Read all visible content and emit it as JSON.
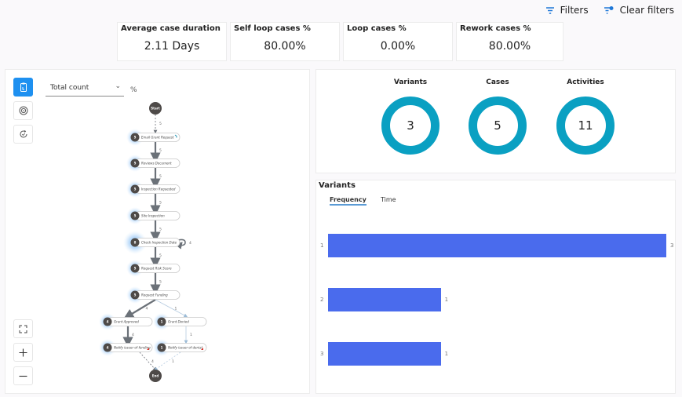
{
  "toolbar": {
    "filters_label": "Filters",
    "clear_filters_label": "Clear filters"
  },
  "kpis": [
    {
      "label": "Average case duration",
      "value": "2.11 Days"
    },
    {
      "label": "Self loop cases %",
      "value": "80.00%"
    },
    {
      "label": "Loop cases %",
      "value": "0.00%"
    },
    {
      "label": "Rework cases %",
      "value": "80.00%"
    }
  ],
  "process_map": {
    "metric_select": {
      "selected": "Total count",
      "unit": "%"
    },
    "tools": [
      "process-map-icon",
      "target-icon",
      "refresh-check-icon"
    ],
    "controls": [
      "fit-screen-icon",
      "zoom-in-icon",
      "zoom-out-icon"
    ],
    "start_label": "Start",
    "end_label": "End",
    "nodes": [
      {
        "id": "n1",
        "label": "Email Grant Request",
        "count": "5"
      },
      {
        "id": "n2",
        "label": "Reviews Document",
        "count": "5"
      },
      {
        "id": "n3",
        "label": "Inspection Requested",
        "count": "5"
      },
      {
        "id": "n4",
        "label": "Site Inspection",
        "count": "5"
      },
      {
        "id": "n5",
        "label": "Check Inspection Date",
        "count": "8"
      },
      {
        "id": "n6",
        "label": "Request Risk Score",
        "count": "5"
      },
      {
        "id": "n7",
        "label": "Request Funding",
        "count": "5"
      },
      {
        "id": "n8",
        "label": "Grant Approved",
        "count": "4"
      },
      {
        "id": "n9",
        "label": "Grant Denied",
        "count": "1"
      },
      {
        "id": "n10",
        "label": "Notify issuer of funding",
        "count": "4"
      },
      {
        "id": "n11",
        "label": "Notify issuer of denial",
        "count": "1"
      }
    ],
    "edges": [
      {
        "from": "start",
        "to": "n1",
        "count": "5"
      },
      {
        "from": "n1",
        "to": "n2",
        "count": "5"
      },
      {
        "from": "n2",
        "to": "n3",
        "count": "5"
      },
      {
        "from": "n3",
        "to": "n4",
        "count": "5"
      },
      {
        "from": "n4",
        "to": "n5",
        "count": "5"
      },
      {
        "from": "n5",
        "to": "n5",
        "count": "4"
      },
      {
        "from": "n5",
        "to": "n6",
        "count": "5"
      },
      {
        "from": "n6",
        "to": "n7",
        "count": "5"
      },
      {
        "from": "n7",
        "to": "n8",
        "count": "4"
      },
      {
        "from": "n7",
        "to": "n9",
        "count": "1"
      },
      {
        "from": "n8",
        "to": "n10",
        "count": "4"
      },
      {
        "from": "n9",
        "to": "n11",
        "count": "1"
      },
      {
        "from": "n10",
        "to": "end",
        "count": "4"
      },
      {
        "from": "n11",
        "to": "end",
        "count": "1"
      }
    ]
  },
  "summary": [
    {
      "label": "Variants",
      "value": "3"
    },
    {
      "label": "Cases",
      "value": "5"
    },
    {
      "label": "Activities",
      "value": "11"
    }
  ],
  "variants": {
    "title": "Variants",
    "tabs": [
      {
        "label": "Frequency",
        "active": true
      },
      {
        "label": "Time",
        "active": false
      }
    ],
    "color": "#4a6bed"
  },
  "chart_data": {
    "type": "bar",
    "orientation": "horizontal",
    "title": "Variants",
    "categories": [
      "1",
      "2",
      "3"
    ],
    "values": [
      3,
      1,
      1
    ],
    "xlim": [
      0,
      3
    ],
    "data_labels": [
      "3",
      "1",
      "1"
    ]
  }
}
